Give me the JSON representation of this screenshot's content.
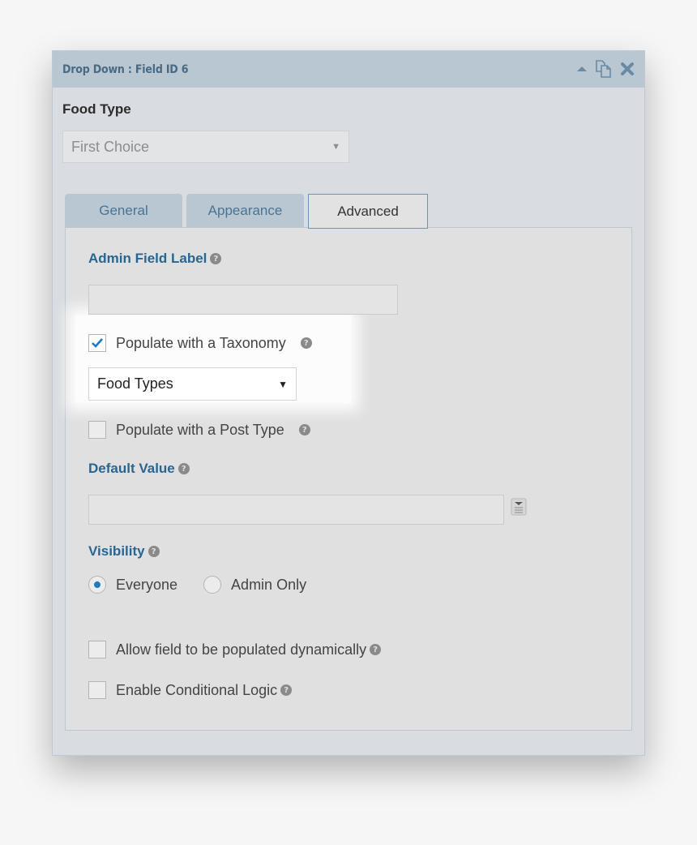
{
  "panel": {
    "title": "Drop Down : Field ID 6",
    "icons": [
      "collapse-arrow-icon",
      "duplicate-icon",
      "close-icon"
    ]
  },
  "preview": {
    "field_label": "Food Type",
    "select_value": "First Choice"
  },
  "tabs": [
    {
      "label": "General",
      "active": false
    },
    {
      "label": "Appearance",
      "active": false
    },
    {
      "label": "Advanced",
      "active": true
    }
  ],
  "advanced": {
    "admin_field_label": {
      "label": "Admin Field Label",
      "value": ""
    },
    "populate_taxonomy": {
      "label": "Populate with a Taxonomy",
      "checked": true
    },
    "taxonomy_select": {
      "value": "Food Types"
    },
    "populate_post_type": {
      "label": "Populate with a Post Type",
      "checked": false
    },
    "default_value": {
      "label": "Default Value",
      "value": ""
    },
    "visibility": {
      "label": "Visibility",
      "options": [
        {
          "label": "Everyone",
          "selected": true
        },
        {
          "label": "Admin Only",
          "selected": false
        }
      ]
    },
    "allow_dynamic": {
      "label": "Allow field to be populated dynamically",
      "checked": false
    },
    "conditional_logic": {
      "label": "Enable Conditional Logic",
      "checked": false
    }
  },
  "help_glyph": "?",
  "select_arrow": "▼",
  "colors": {
    "header_bg": "#b9c7d2",
    "accent_label": "#276692",
    "check_color": "#1e7bbd"
  }
}
